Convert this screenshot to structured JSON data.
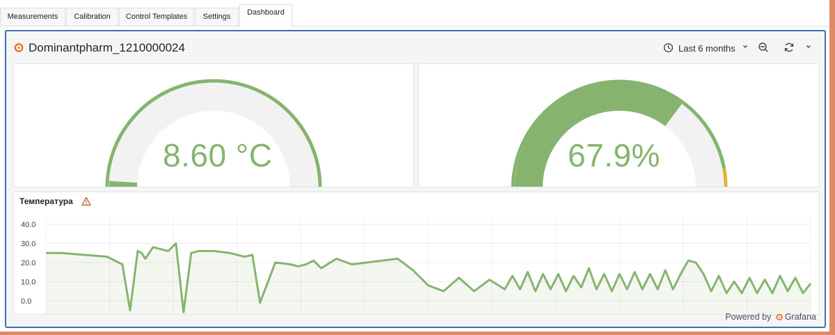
{
  "tabs": [
    {
      "label": "Measurements",
      "active": false
    },
    {
      "label": "Calibration",
      "active": false
    },
    {
      "label": "Control Templates",
      "active": false
    },
    {
      "label": "Settings",
      "active": false
    },
    {
      "label": "Dashboard",
      "active": true
    }
  ],
  "dashboard": {
    "title": "Dominantpharm_1210000024",
    "time_range": "Last 6 months",
    "powered_by": "Powered by",
    "brand": "Grafana"
  },
  "gauges": [
    {
      "value_text": "8.60 °C",
      "value": 8.6,
      "fill_fraction": 0.08,
      "color": "#86b46f"
    },
    {
      "value_text": "67.9%",
      "value": 67.9,
      "fill_fraction": 0.679,
      "color": "#86b46f",
      "thresholds": [
        {
          "color": "#86b46f"
        },
        {
          "color": "#e0b43a"
        },
        {
          "color": "#c4232b"
        }
      ]
    }
  ],
  "chart_data": {
    "type": "line",
    "title": "Температура",
    "y_ticks": [
      "40.0",
      "30.0",
      "20.0",
      "10.0",
      "0.0"
    ],
    "ylim": [
      -7,
      44
    ],
    "grid": true,
    "series": [
      {
        "color": "#86b46f",
        "x": [
          0,
          2,
          5,
          8,
          10,
          11,
          12,
          12.5,
          13,
          14,
          15,
          16,
          17,
          18,
          19,
          20,
          22,
          24,
          25,
          26,
          27,
          28,
          30,
          32,
          33,
          34,
          35,
          36,
          38,
          40,
          42,
          44,
          46,
          48,
          50,
          52,
          54,
          56,
          58,
          60,
          61,
          62,
          63,
          64,
          65,
          66,
          67,
          68,
          69,
          70,
          71,
          72,
          73,
          74,
          75,
          76,
          77,
          78,
          79,
          80,
          81,
          82,
          83,
          84,
          85,
          86,
          87,
          88,
          89,
          90,
          91,
          92,
          93,
          94,
          95,
          96,
          97,
          98,
          99,
          100
        ],
        "y": [
          25,
          25,
          24,
          23,
          19,
          -5,
          26,
          25,
          22,
          28,
          27,
          26,
          30,
          -6,
          25,
          26,
          26,
          25,
          24,
          23,
          24,
          -1,
          20,
          19,
          18,
          19,
          21,
          17,
          22,
          19,
          20,
          21,
          22,
          16,
          8,
          5,
          12,
          5,
          11,
          6,
          13,
          6,
          15,
          5,
          14,
          6,
          14,
          5,
          13,
          7,
          17,
          6,
          14,
          5,
          14,
          6,
          15,
          6,
          14,
          6,
          16,
          6,
          14,
          21,
          20,
          14,
          5,
          13,
          4,
          10,
          4,
          12,
          4,
          11,
          4,
          13,
          5,
          12,
          4,
          9
        ]
      }
    ]
  }
}
